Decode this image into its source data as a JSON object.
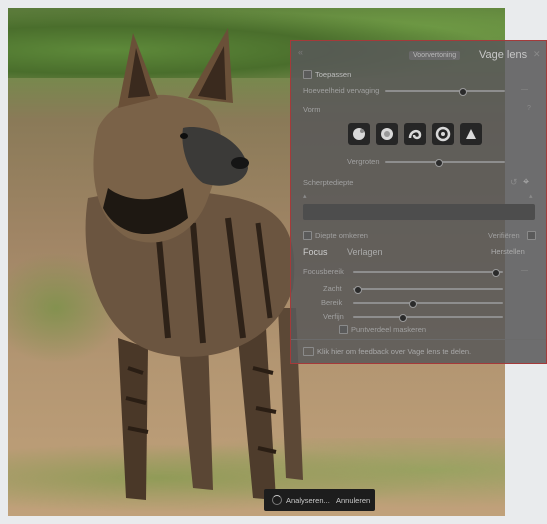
{
  "panel": {
    "collapse_icon": "chevron-icon",
    "badge": "Voorvertoning",
    "title": "Vage lens",
    "close_icon": "close-icon",
    "apply_label": "Toepassen",
    "amount_label": "Hoeveelheid vervaging",
    "shape_label": "Vorm",
    "size_label": "Vergroten",
    "tool_icons": [
      "bokeh-circle-icon",
      "bokeh-ring-icon",
      "bokeh-swirl-icon",
      "bokeh-donut-icon",
      "bokeh-triangle-icon"
    ],
    "section_label": "Scherptediepte",
    "target_icon": "target-icon",
    "invert_label": "Diepte omkeren",
    "verify_label": "Verifiëren",
    "tabs": [
      "Focus",
      "Verlagen",
      "Herstellen"
    ],
    "focus_label": "Focusbereik",
    "soft_label": "Zacht",
    "range_label": "Bereik",
    "refine_label": "Verfijn",
    "mask_label": "Puntverdeel maskeren",
    "feedback": "Klik hier om feedback over Vage lens te delen."
  },
  "analyze": {
    "spinner_icon": "spinner-icon",
    "status": "Analyseren...",
    "cancel": "Annuleren"
  },
  "sliders": {
    "amount": 0.65,
    "size": 0.45,
    "focus": 0.95,
    "soft": 0.03,
    "range": 0.4,
    "refine": 0.33
  }
}
